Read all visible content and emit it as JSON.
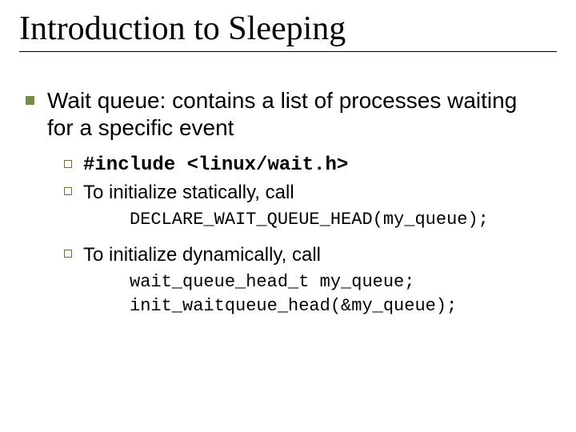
{
  "title": "Introduction to Sleeping",
  "lvl1": {
    "text": "Wait queue:  contains a list of processes waiting for a specific event"
  },
  "items": [
    {
      "text": "#include <linux/wait.h>",
      "mono": true
    },
    {
      "text": "To initialize statically, call"
    }
  ],
  "code1": "DECLARE_WAIT_QUEUE_HEAD(my_queue);",
  "item3": {
    "text": "To initialize dynamically, call"
  },
  "code2a": "wait_queue_head_t my_queue;",
  "code2b": "init_waitqueue_head(&my_queue);"
}
